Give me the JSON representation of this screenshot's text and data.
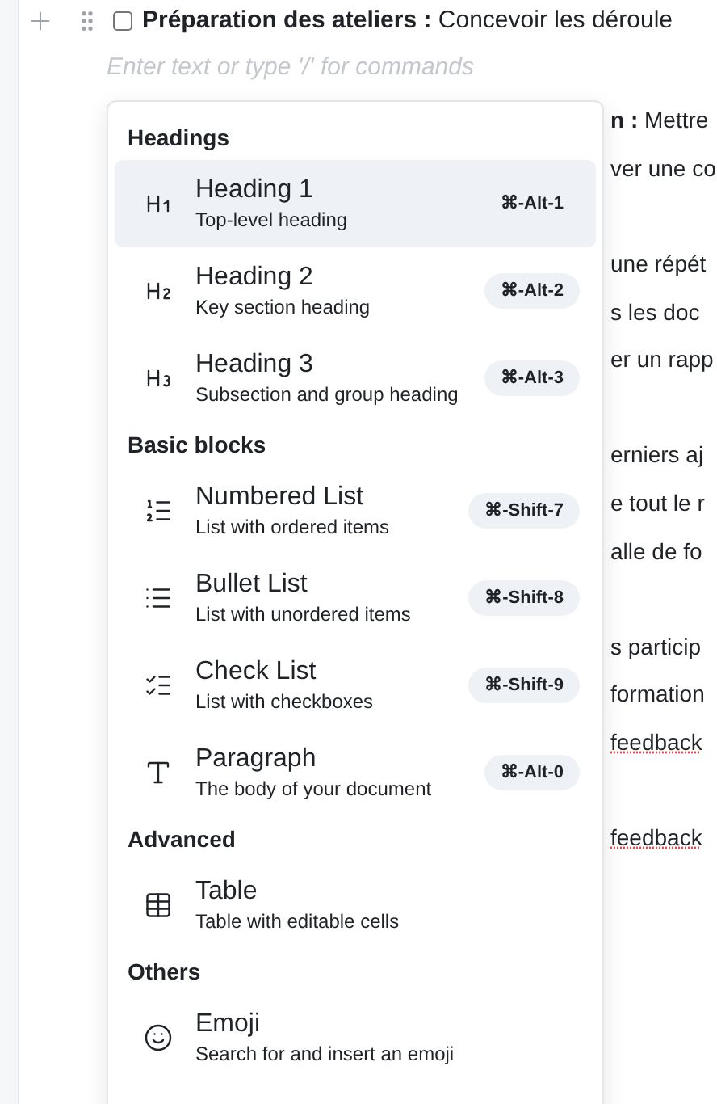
{
  "document": {
    "first_line": {
      "checked": false,
      "text": "**Préparation des ateliers :** Concevoir les déroule"
    },
    "placeholder": "Enter text or type '/' for commands",
    "blocks": [
      {
        "lines": [
          {
            "text": "**n :** Mettre",
            "misspelled": false
          },
          {
            "text": "ver une co",
            "misspelled": false
          }
        ]
      },
      {
        "lines": [
          {
            "text": "une répét",
            "misspelled": false
          },
          {
            "text": "s les doc",
            "misspelled": false
          },
          {
            "text": "er un rapp",
            "misspelled": false
          }
        ]
      },
      {
        "lines": [
          {
            "text": "erniers aj",
            "misspelled": false
          },
          {
            "text": "e tout le r",
            "misspelled": false
          },
          {
            "text": "alle de fo",
            "misspelled": false
          }
        ]
      },
      {
        "lines": [
          {
            "text": "s particip",
            "misspelled": false
          },
          {
            "text": "formation",
            "misspelled": false
          },
          {
            "text": "feedback",
            "misspelled": true
          }
        ]
      },
      {
        "lines": [
          {
            "text": "feedback",
            "misspelled": true
          }
        ]
      }
    ]
  },
  "menu": {
    "sections": [
      {
        "title": "Headings",
        "items": [
          {
            "kind": "h1",
            "title": "Heading 1",
            "subtitle": "Top-level heading",
            "shortcut": "⌘-Alt-1",
            "selected": true
          },
          {
            "kind": "h2",
            "title": "Heading 2",
            "subtitle": "Key section heading",
            "shortcut": "⌘-Alt-2",
            "selected": false
          },
          {
            "kind": "h3",
            "title": "Heading 3",
            "subtitle": "Subsection and group heading",
            "shortcut": "⌘-Alt-3",
            "selected": false
          }
        ]
      },
      {
        "title": "Basic blocks",
        "items": [
          {
            "kind": "numbered",
            "title": "Numbered List",
            "subtitle": "List with ordered items",
            "shortcut": "⌘-Shift-7",
            "selected": false
          },
          {
            "kind": "bullet",
            "title": "Bullet List",
            "subtitle": "List with unordered items",
            "shortcut": "⌘-Shift-8",
            "selected": false
          },
          {
            "kind": "check",
            "title": "Check List",
            "subtitle": "List with checkboxes",
            "shortcut": "⌘-Shift-9",
            "selected": false
          },
          {
            "kind": "paragraph",
            "title": "Paragraph",
            "subtitle": "The body of your document",
            "shortcut": "⌘-Alt-0",
            "selected": false
          }
        ]
      },
      {
        "title": "Advanced",
        "items": [
          {
            "kind": "table",
            "title": "Table",
            "subtitle": "Table with editable cells",
            "selected": false
          }
        ]
      },
      {
        "title": "Others",
        "items": [
          {
            "kind": "emoji",
            "title": "Emoji",
            "subtitle": "Search for and insert an emoji",
            "selected": false
          }
        ]
      }
    ]
  }
}
